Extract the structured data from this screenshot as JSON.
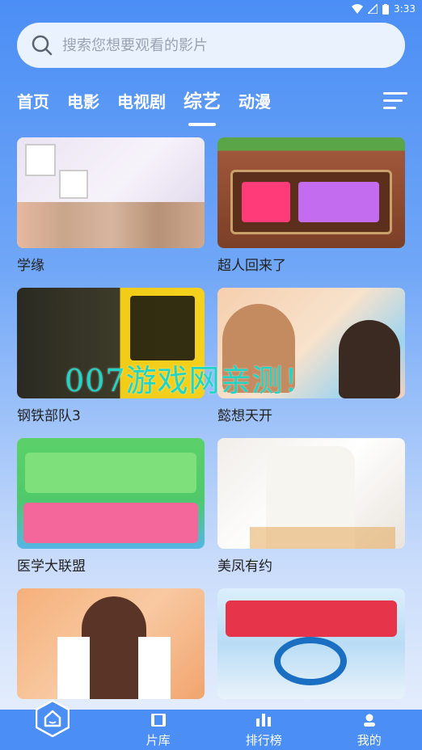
{
  "status_bar": {
    "time": "3:33"
  },
  "search": {
    "placeholder": "搜索您想要观看的影片"
  },
  "tabs": [
    {
      "label": "首页",
      "active": false
    },
    {
      "label": "电影",
      "active": false
    },
    {
      "label": "电视剧",
      "active": false
    },
    {
      "label": "综艺",
      "active": true
    },
    {
      "label": "动漫",
      "active": false
    }
  ],
  "shows": [
    {
      "title": "学缘"
    },
    {
      "title": "超人回来了"
    },
    {
      "title": "钢铁部队3"
    },
    {
      "title": "懿想天开"
    },
    {
      "title": "医学大联盟"
    },
    {
      "title": "美凤有约"
    },
    {
      "title": ""
    },
    {
      "title": ""
    }
  ],
  "watermark": "007游戏网亲测！",
  "bottom_nav": [
    {
      "label": "",
      "icon": "home-icon"
    },
    {
      "label": "片库",
      "icon": "film-icon"
    },
    {
      "label": "排行榜",
      "icon": "chart-icon"
    },
    {
      "label": "我的",
      "icon": "user-icon"
    }
  ],
  "colors": {
    "primary": "#4b8ef5",
    "watermark": "#1fd6c6"
  }
}
